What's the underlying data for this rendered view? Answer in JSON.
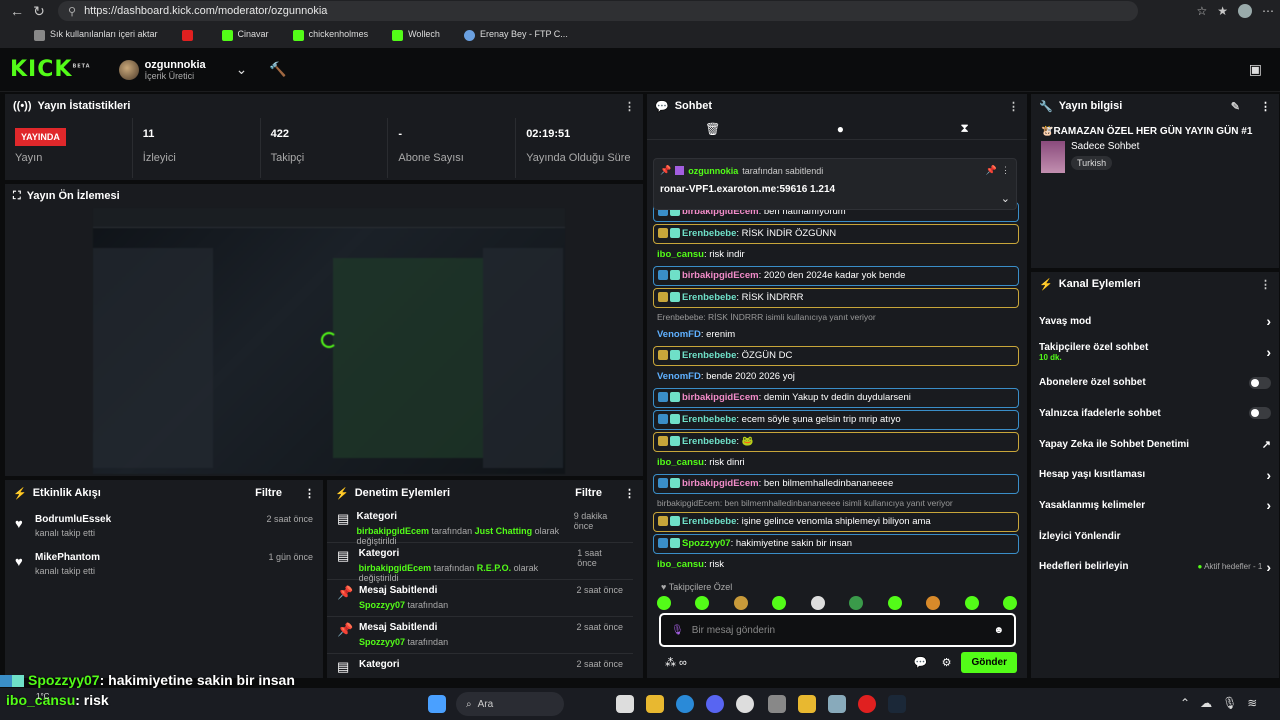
{
  "browser": {
    "url": "https://dashboard.kick.com/moderator/ozgunnokia",
    "bookmarks": [
      "Sık kullanılanları içeri aktar",
      "Cinavar",
      "chickenholmes",
      "Wollech",
      "Erenay Bey - FTP C..."
    ]
  },
  "topbar": {
    "logo": "KICK",
    "beta": "BETA",
    "username": "ozgunnokia",
    "role": "İçerik Üretici"
  },
  "stats": {
    "title": "Yayın İstatistikleri",
    "live_badge": "YAYINDA",
    "items": [
      {
        "value": "",
        "label": "Yayın"
      },
      {
        "value": "11",
        "label": "İzleyici"
      },
      {
        "value": "422",
        "label": "Takipçi"
      },
      {
        "value": "-",
        "label": "Abone Sayısı"
      },
      {
        "value": "02:19:51",
        "label": "Yayında Olduğu Süre"
      }
    ]
  },
  "preview": {
    "title": "Yayın Ön İzlemesi"
  },
  "activity": {
    "title": "Etkinlik Akışı",
    "filter": "Filtre",
    "items": [
      {
        "name": "BodrumluEssek",
        "sub": "kanalı takip etti",
        "time": "2 saat önce"
      },
      {
        "name": "MikePhantom",
        "sub": "kanalı takip etti",
        "time": "1 gün önce"
      }
    ]
  },
  "modlog": {
    "title": "Denetim Eylemleri",
    "filter": "Filtre",
    "items": [
      {
        "title": "Kategori",
        "user": "birbakipgidEcem",
        "mid": "tarafından",
        "target": "Just Chatting",
        "end": "olarak değiştirildi",
        "time": "9 dakika önce"
      },
      {
        "title": "Kategori",
        "user": "birbakipgidEcem",
        "mid": "tarafından",
        "target": "R.E.P.O.",
        "end": "olarak değiştirildi",
        "time": "1 saat önce"
      },
      {
        "title": "Mesaj Sabitlendi",
        "user": "Spozzyy07",
        "mid": "tarafından",
        "target": "",
        "end": "",
        "time": "2 saat önce"
      },
      {
        "title": "Mesaj Sabitlendi",
        "user": "Spozzyy07",
        "mid": "tarafından",
        "target": "",
        "end": "",
        "time": "2 saat önce"
      },
      {
        "title": "Kategori",
        "user": "",
        "mid": "",
        "target": "",
        "end": "",
        "time": "2 saat önce"
      }
    ]
  },
  "chat": {
    "title": "Sohbet",
    "pinned_by": "ozgunnokia",
    "pinned_by_suffix": "tarafından sabitlendi",
    "pinned_text": "ronar-VPF1.exaroton.me:59616 1.214",
    "messages": [
      {
        "user": "birbakipgidEcem",
        "text": "ben hatırlamıyorum",
        "color": "#f28cc9",
        "style": "blue"
      },
      {
        "user": "Erenbebebe",
        "text": "RİSK İNDİR ÖZGÜNN",
        "color": "#6fe0c8",
        "style": "gold"
      },
      {
        "user": "ibo_cansu",
        "text": "risk indir",
        "color": "#53fc18",
        "style": ""
      },
      {
        "user": "birbakipgidEcem",
        "text": "2020 den 2024e kadar yok bende",
        "color": "#f28cc9",
        "style": "blue"
      },
      {
        "user": "Erenbebebe",
        "text": "RİSK İNDRRR",
        "color": "#6fe0c8",
        "style": "gold"
      },
      {
        "reply": "Erenbebebe: RİSK İNDRRR isimli kullanıcıya yanıt veriyor"
      },
      {
        "user": "VenomFD",
        "text": "erenim",
        "color": "#5fb0ff",
        "style": ""
      },
      {
        "user": "Erenbebebe",
        "text": "ÖZGÜN DC",
        "color": "#6fe0c8",
        "style": "gold"
      },
      {
        "user": "VenomFD",
        "text": "bende 2020 2026 yoj",
        "color": "#5fb0ff",
        "style": ""
      },
      {
        "user": "birbakipgidEcem",
        "text": "demin Yakup tv dedin duydularseni",
        "color": "#f28cc9",
        "style": "blue"
      },
      {
        "user": "Erenbebebe",
        "text": "ecem söyle şuna gelsin trip mrip atıyo",
        "color": "#6fe0c8",
        "style": "blue"
      },
      {
        "user": "Erenbebebe",
        "text": "🐸",
        "color": "#6fe0c8",
        "style": "gold"
      },
      {
        "user": "ibo_cansu",
        "text": "risk dinri",
        "color": "#53fc18",
        "style": ""
      },
      {
        "user": "birbakipgidEcem",
        "text": "ben bilmemhalledinbananeeee",
        "color": "#f28cc9",
        "style": "blue"
      },
      {
        "reply": "birbakipgidEcem: ben bilmemhalledinbananeeee isimli kullanıcıya yanıt veriyor"
      },
      {
        "user": "Erenbebebe",
        "text": "işine gelince venomla shiplemeyi biliyon ama",
        "color": "#6fe0c8",
        "style": "gold"
      },
      {
        "user": "Spozzyy07",
        "text": "hakimiyetine sakin bir insan",
        "color": "#53fc18",
        "style": "blue"
      },
      {
        "user": "ibo_cansu",
        "text": "risk",
        "color": "#53fc18",
        "style": ""
      }
    ],
    "quick_label": "Takipçilere Özel",
    "input_placeholder": "Bir mesaj gönderin",
    "send_label": "Gönder"
  },
  "stream_info": {
    "title": "Yayın bilgisi",
    "stream_title": "🐮RAMAZAN ÖZEL HER GÜN YAYIN GÜN #1",
    "category": "Sadece Sohbet",
    "tag": "Turkish"
  },
  "channel_actions": {
    "title": "Kanal Eylemleri",
    "rows": [
      {
        "label": "Yavaş mod",
        "sub": "",
        "control": "chevron"
      },
      {
        "label": "Takipçilere özel sohbet",
        "sub": "10 dk.",
        "control": "chevron"
      },
      {
        "label": "Abonelere özel sohbet",
        "sub": "",
        "control": "toggle"
      },
      {
        "label": "Yalnızca ifadelerle sohbet",
        "sub": "",
        "control": "toggle"
      },
      {
        "label": "Yapay Zeka ile Sohbet Denetimi",
        "sub": "",
        "control": "external"
      },
      {
        "label": "Hesap yaşı kısıtlaması",
        "sub": "",
        "control": "chevron"
      },
      {
        "label": "Yasaklanmış kelimeler",
        "sub": "",
        "control": "chevron"
      },
      {
        "label": "İzleyici Yönlendir",
        "sub": "",
        "control": ""
      },
      {
        "label": "Hedefleri belirleyin",
        "sub": "",
        "control": "goals"
      }
    ],
    "goals_text": "Aktif hedefler - 1"
  },
  "overlay": {
    "line1_user": "Spozzyy07",
    "line1_text": ": hakimiyetine sakin bir insan",
    "line2_user": "ibo_cansu",
    "line2_text": ": risk"
  },
  "taskbar": {
    "search": "Ara",
    "temp": "1°C"
  }
}
